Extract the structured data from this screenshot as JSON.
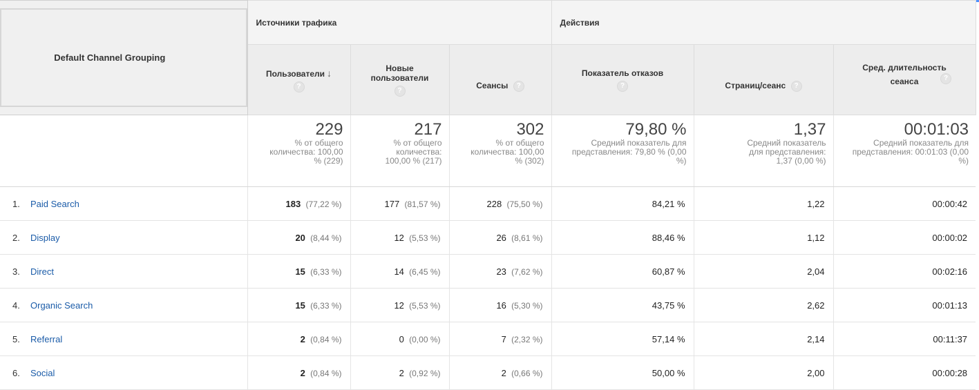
{
  "header": {
    "dimension": "Default Channel Grouping",
    "groups": [
      "Источники трафика",
      "Действия"
    ],
    "metrics": [
      {
        "label": "Пользователи"
      },
      {
        "label": "Новые пользователи"
      },
      {
        "label": "Сеансы"
      },
      {
        "label": "Показатель отказов"
      },
      {
        "label": "Страниц/сеанс"
      },
      {
        "label": "Сред. длительность сеанса"
      }
    ],
    "help_glyph": "?",
    "sort_glyph": "↓"
  },
  "totals": [
    {
      "value": "229",
      "sub": "% от общего количества: 100,00 % (229)"
    },
    {
      "value": "217",
      "sub": "% от общего количества: 100,00 % (217)"
    },
    {
      "value": "302",
      "sub": "% от общего количества: 100,00 % (302)"
    },
    {
      "value": "79,80 %",
      "sub": "Средний показатель для представления: 79,80 % (0,00 %)"
    },
    {
      "value": "1,37",
      "sub": "Средний показатель для представления: 1,37 (0,00 %)"
    },
    {
      "value": "00:01:03",
      "sub": "Средний показатель для представления: 00:01:03 (0,00 %)"
    }
  ],
  "rows": [
    {
      "idx": "1.",
      "channel": "Paid Search",
      "users": "183",
      "users_pct": "(77,22 %)",
      "new_users": "177",
      "new_users_pct": "(81,57 %)",
      "sessions": "228",
      "sessions_pct": "(75,50 %)",
      "bounce": "84,21 %",
      "pages": "1,22",
      "duration": "00:00:42"
    },
    {
      "idx": "2.",
      "channel": "Display",
      "users": "20",
      "users_pct": "(8,44 %)",
      "new_users": "12",
      "new_users_pct": "(5,53 %)",
      "sessions": "26",
      "sessions_pct": "(8,61 %)",
      "bounce": "88,46 %",
      "pages": "1,12",
      "duration": "00:00:02"
    },
    {
      "idx": "3.",
      "channel": "Direct",
      "users": "15",
      "users_pct": "(6,33 %)",
      "new_users": "14",
      "new_users_pct": "(6,45 %)",
      "sessions": "23",
      "sessions_pct": "(7,62 %)",
      "bounce": "60,87 %",
      "pages": "2,04",
      "duration": "00:02:16"
    },
    {
      "idx": "4.",
      "channel": "Organic Search",
      "users": "15",
      "users_pct": "(6,33 %)",
      "new_users": "12",
      "new_users_pct": "(5,53 %)",
      "sessions": "16",
      "sessions_pct": "(5,30 %)",
      "bounce": "43,75 %",
      "pages": "2,62",
      "duration": "00:01:13"
    },
    {
      "idx": "5.",
      "channel": "Referral",
      "users": "2",
      "users_pct": "(0,84 %)",
      "new_users": "0",
      "new_users_pct": "(0,00 %)",
      "sessions": "7",
      "sessions_pct": "(2,32 %)",
      "bounce": "57,14 %",
      "pages": "2,14",
      "duration": "00:11:37"
    },
    {
      "idx": "6.",
      "channel": "Social",
      "users": "2",
      "users_pct": "(0,84 %)",
      "new_users": "2",
      "new_users_pct": "(0,92 %)",
      "sessions": "2",
      "sessions_pct": "(0,66 %)",
      "bounce": "50,00 %",
      "pages": "2,00",
      "duration": "00:00:28"
    }
  ]
}
